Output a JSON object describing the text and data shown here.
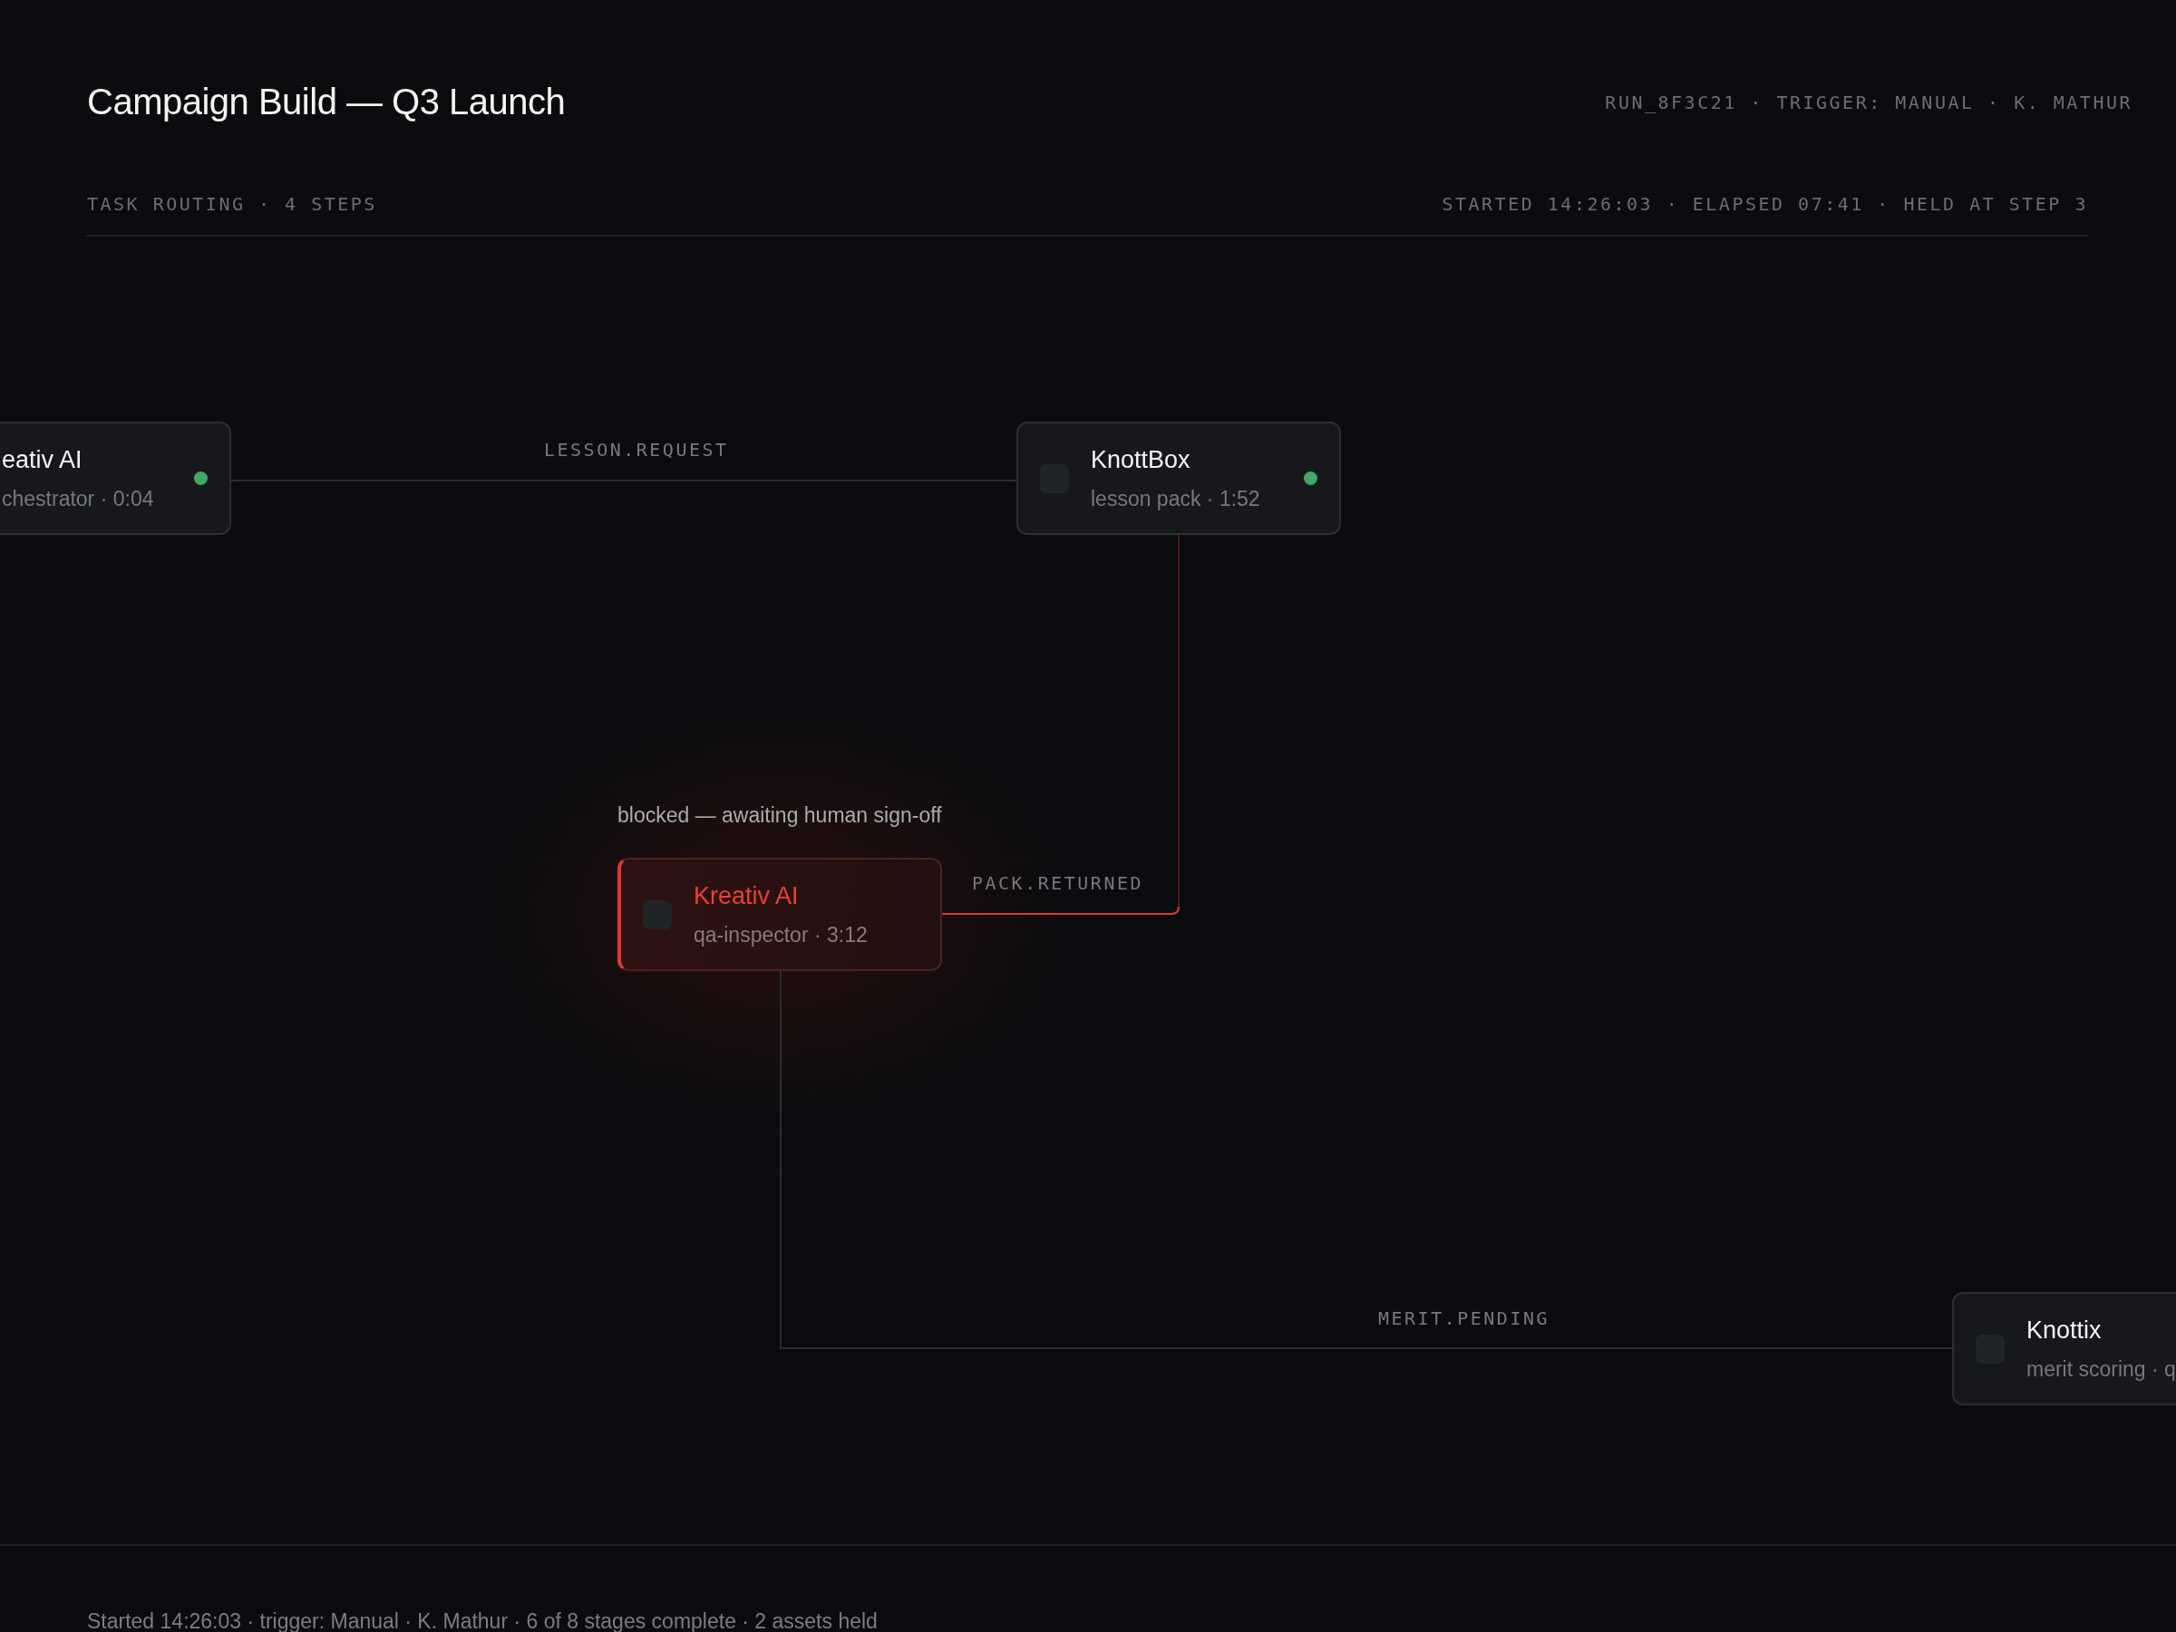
{
  "header": {
    "title": "Campaign Build — Q3 Launch",
    "meta": "RUN_8F3C21 · TRIGGER: MANUAL · K. MATHUR"
  },
  "subheader": {
    "left": "TASK ROUTING · 4 STEPS",
    "right": "STARTED 14:26:03 · ELAPSED 07:41 · HELD AT STEP 3"
  },
  "nodes": [
    {
      "name": "eativ AI",
      "detail": "chestrator · 0:04",
      "done": true,
      "blocked": false
    },
    {
      "name": "KnottBox",
      "detail": "lesson pack · 1:52",
      "done": true,
      "blocked": false
    },
    {
      "name": "Kreativ AI",
      "detail": "qa-inspector · 3:12",
      "done": false,
      "blocked": true,
      "note": "blocked — awaiting human sign-off"
    },
    {
      "name": "Knottix",
      "detail": "merit scoring · q",
      "blocked": false
    }
  ],
  "edges": [
    {
      "label": "LESSON.REQUEST",
      "alert": false
    },
    {
      "label": "PACK.RETURNED",
      "alert": true
    },
    {
      "label": "MERIT.PENDING",
      "alert": false
    }
  ],
  "footer": "Started 14:26:03 · trigger: Manual · K. Mathur · 6 of 8 stages complete · 2 assets held"
}
